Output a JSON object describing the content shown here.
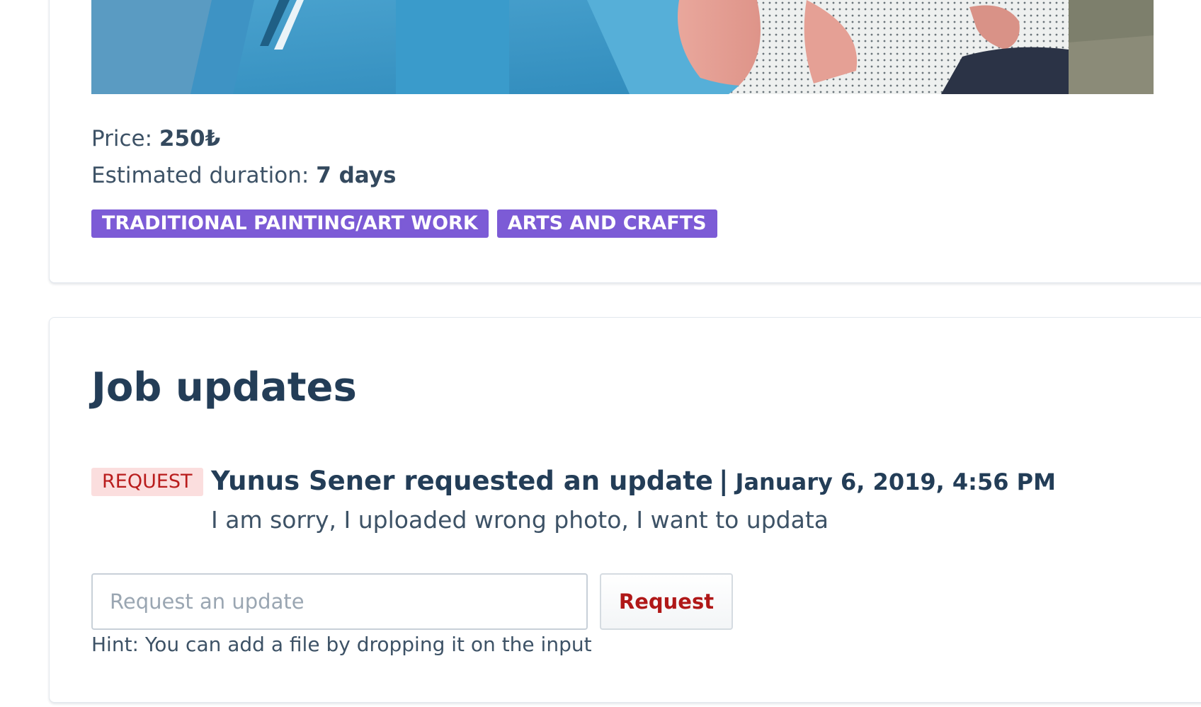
{
  "job": {
    "price_label": "Price: ",
    "price_value": "250₺",
    "duration_label": "Estimated duration: ",
    "duration_value": "7 days",
    "tags": [
      "TRADITIONAL PAINTING/ART WORK",
      "ARTS AND CRAFTS"
    ]
  },
  "updates": {
    "title": "Job updates",
    "items": [
      {
        "badge": "REQUEST",
        "headline": "Yunus Sener requested an update",
        "separator": "|",
        "timestamp": "January 6, 2019, 4:56 PM",
        "message": "I am sorry, I uploaded wrong photo, I want to updata"
      }
    ],
    "input_placeholder": "Request an update",
    "input_value": "",
    "button_label": "Request",
    "hint": "Hint: You can add a file by dropping it on the input"
  },
  "colors": {
    "tag_bg": "#7c5bd6",
    "badge_bg": "#fbdede",
    "badge_text": "#b91c1c",
    "heading": "#233d57",
    "button_text": "#b01818"
  },
  "icons": [
    "job-photo-image"
  ]
}
